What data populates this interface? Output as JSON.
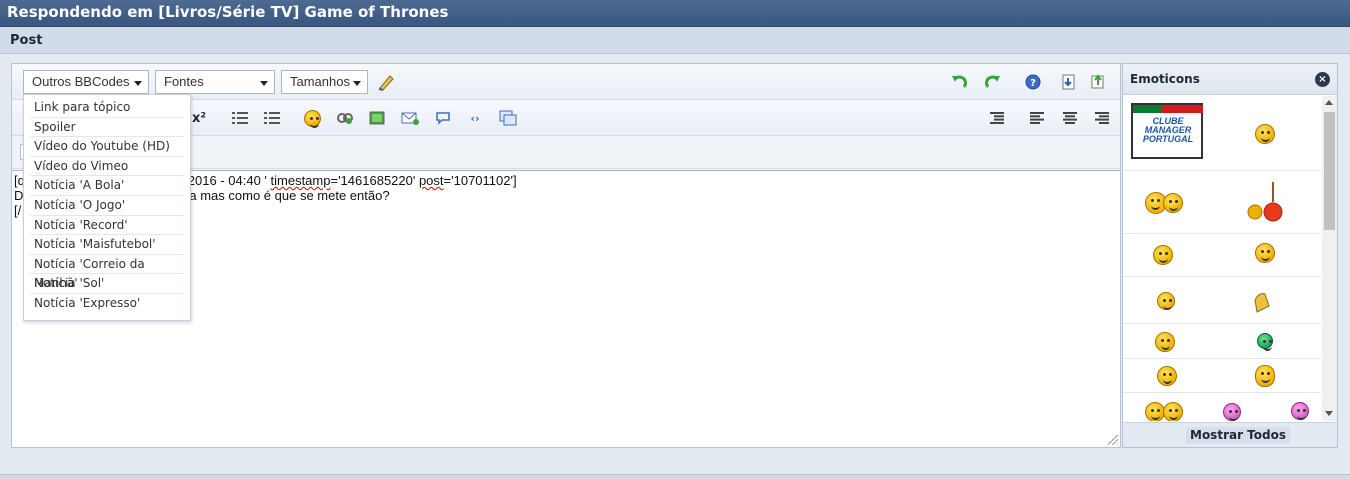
{
  "window": {
    "title": "Respondendo em [Livros/Série TV] Game of Thrones",
    "section": "Post"
  },
  "toolbar": {
    "bbcodes_label": "Outros BBCodes",
    "fonts_label": "Fontes",
    "sizes_label": "Tamanhos"
  },
  "menu": {
    "items": [
      "Link para tópico",
      "Spoiler",
      "Vídeo do Youtube (HD)",
      "Vídeo do Vimeo",
      "Notícia 'A Bola'",
      "Notícia 'O Jogo'",
      "Notícia 'Record'",
      "Notícia 'Maisfutebol'",
      "Notícia 'Correio da Manhã'",
      "Notícia 'Sol'",
      "Notícia 'Expresso'"
    ]
  },
  "editor": {
    "line1_pre": "[q",
    "line1_mid": "bril 2016 - 04:40 ' ",
    "line1_ts_key": "timestamp",
    "line1_ts_val": "='1461685220' ",
    "line1_post_key": "post",
    "line1_post_val": "='10701102']",
    "line2_pre": "D",
    "line2_mid": "a mas como é que se mete então?",
    "line3_pre": "[/"
  },
  "emoticons": {
    "title": "Emoticons",
    "logo_text": "CLUBE MANAGER PORTUGAL",
    "show_all_label": "Mostrar Todos"
  },
  "colors": {
    "title_bar": "#3f5c86",
    "accent_green": "#3aa33a",
    "link_blue": "#1b56a8"
  }
}
